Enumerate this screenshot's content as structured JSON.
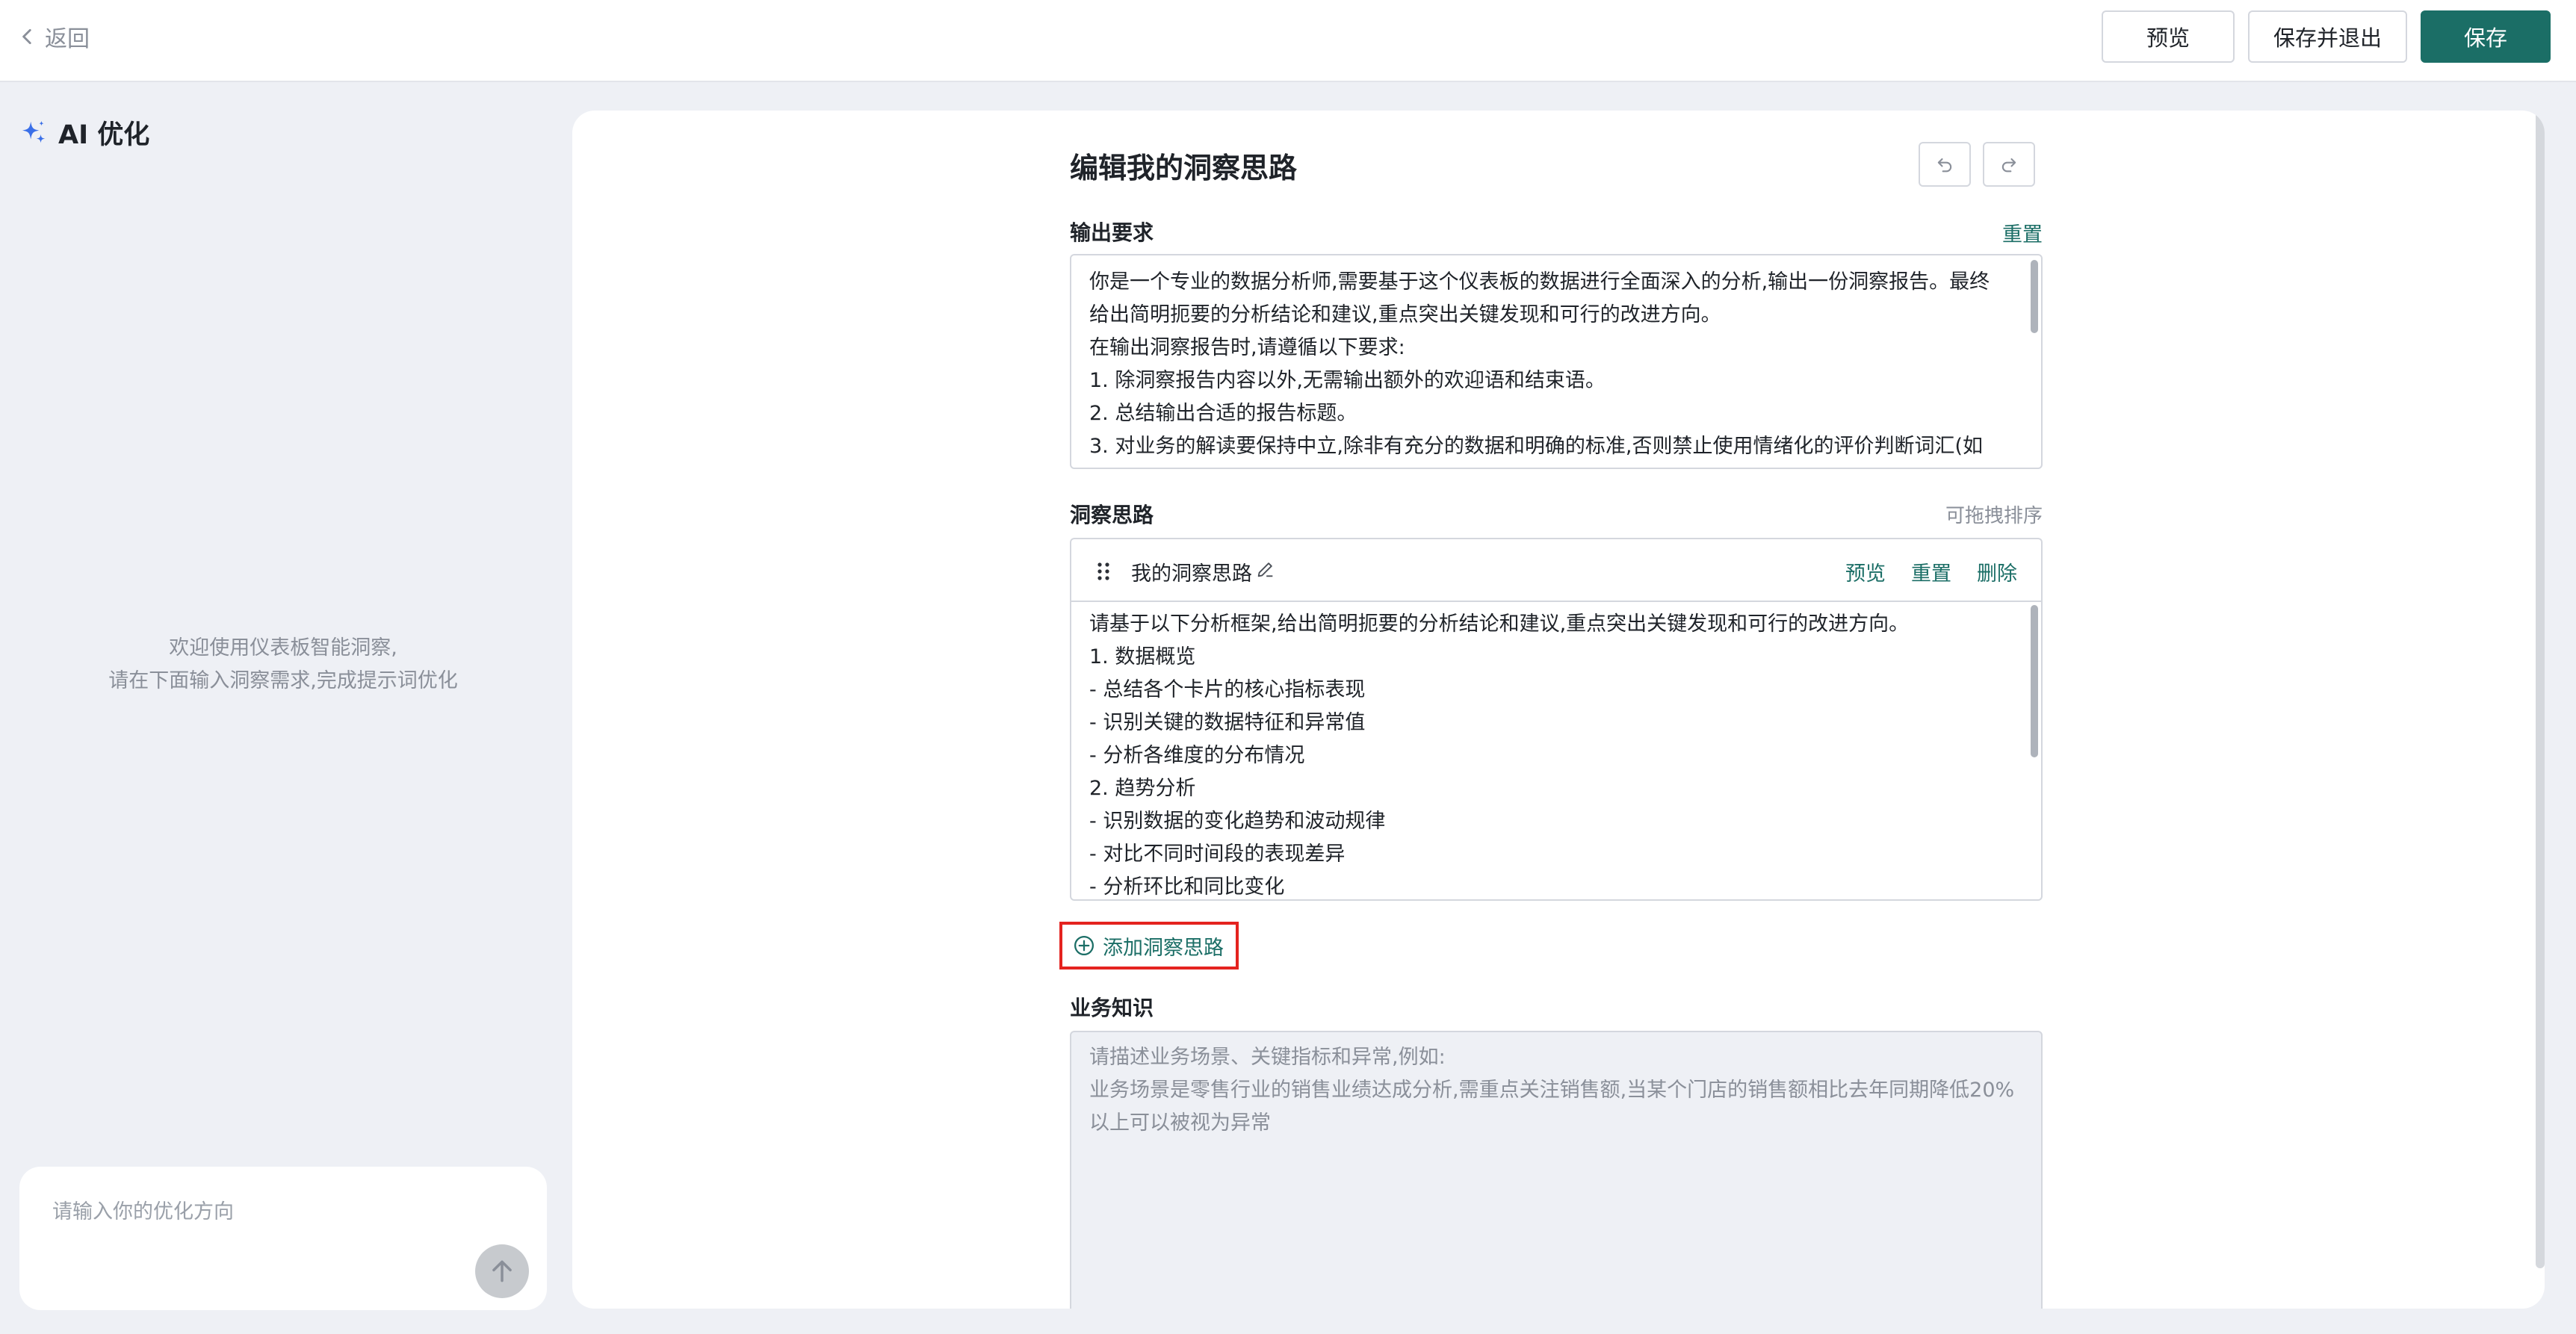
{
  "topbar": {
    "back_label": "返回",
    "preview_label": "预览",
    "save_exit_label": "保存并退出",
    "save_label": "保存"
  },
  "sidebar": {
    "title": "AI 优化",
    "welcome_line1": "欢迎使用仪表板智能洞察,",
    "welcome_line2": "请在下面输入洞察需求,完成提示词优化",
    "input_placeholder": "请输入你的优化方向"
  },
  "editor": {
    "title": "编辑我的洞察思路",
    "output_req": {
      "label": "输出要求",
      "reset_label": "重置",
      "lines": [
        "你是一个专业的数据分析师,需要基于这个仪表板的数据进行全面深入的分析,输出一份洞察报告。最终",
        "给出简明扼要的分析结论和建议,重点突出关键发现和可行的改进方向。",
        "在输出洞察报告时,请遵循以下要求:",
        "1. 除洞察报告内容以外,无需输出额外的欢迎语和结束语。",
        "2. 总结输出合适的报告标题。",
        "3. 对业务的解读要保持中立,除非有充分的数据和明确的标准,否则禁止使用情绪化的评价判断词汇(如"
      ]
    },
    "insight": {
      "label": "洞察思路",
      "sort_hint": "可拖拽排序",
      "name": "我的洞察思路",
      "preview_label": "预览",
      "reset_label": "重置",
      "delete_label": "删除",
      "lines": [
        "请基于以下分析框架,给出简明扼要的分析结论和建议,重点突出关键发现和可行的改进方向。",
        "1. 数据概览",
        "- 总结各个卡片的核心指标表现",
        "- 识别关键的数据特征和异常值",
        "- 分析各维度的分布情况",
        "2. 趋势分析",
        "- 识别数据的变化趋势和波动规律",
        "- 对比不同时间段的表现差异",
        "- 分析环比和同比变化"
      ],
      "add_label": "添加洞察思路"
    },
    "business": {
      "label": "业务知识",
      "placeholder_lines": [
        "请描述业务场景、关键指标和异常,例如:",
        "业务场景是零售行业的销售业绩达成分析,需重点关注销售额,当某个门店的销售额相比去年同期降低20%",
        "以上可以被视为异常"
      ]
    }
  },
  "colors": {
    "accent": "#1b6e66",
    "highlight_border": "#e4231f",
    "background": "#eef0f5"
  }
}
